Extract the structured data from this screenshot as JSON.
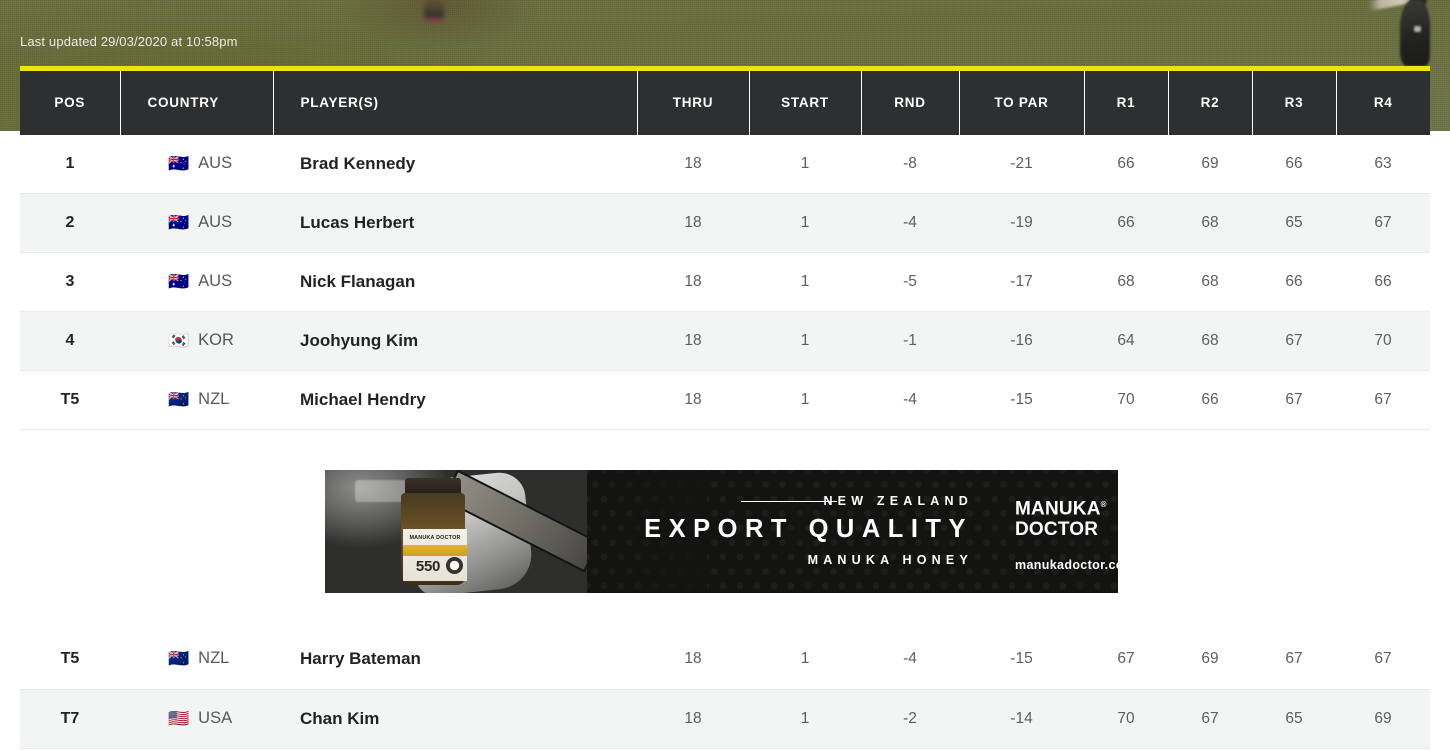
{
  "hero": {
    "last_updated": "Last updated 29/03/2020 at 10:58pm"
  },
  "colors": {
    "accent_yellow": "#f2e310",
    "header_dark": "#2d2f30",
    "row_alt": "#f3f4f4",
    "text_dark": "#1f2326",
    "text_muted": "#55595c",
    "ad_black": "#131312",
    "ad_gold": "#d4b765"
  },
  "leaderboard": {
    "columns": [
      {
        "key": "pos",
        "label": "POS"
      },
      {
        "key": "country",
        "label": "COUNTRY"
      },
      {
        "key": "player",
        "label": "PLAYER(S)"
      },
      {
        "key": "thru",
        "label": "THRU"
      },
      {
        "key": "start",
        "label": "START"
      },
      {
        "key": "rnd",
        "label": "RND"
      },
      {
        "key": "topar",
        "label": "TO PAR"
      },
      {
        "key": "r1",
        "label": "R1"
      },
      {
        "key": "r2",
        "label": "R2"
      },
      {
        "key": "r3",
        "label": "R3"
      },
      {
        "key": "r4",
        "label": "R4"
      }
    ],
    "rows_top": [
      {
        "pos": "1",
        "flag": "🇦🇺",
        "country": "AUS",
        "player": "Brad Kennedy",
        "thru": "18",
        "start": "1",
        "rnd": "-8",
        "topar": "-21",
        "r1": "66",
        "r2": "69",
        "r3": "66",
        "r4": "63"
      },
      {
        "pos": "2",
        "flag": "🇦🇺",
        "country": "AUS",
        "player": "Lucas Herbert",
        "thru": "18",
        "start": "1",
        "rnd": "-4",
        "topar": "-19",
        "r1": "66",
        "r2": "68",
        "r3": "65",
        "r4": "67"
      },
      {
        "pos": "3",
        "flag": "🇦🇺",
        "country": "AUS",
        "player": "Nick Flanagan",
        "thru": "18",
        "start": "1",
        "rnd": "-5",
        "topar": "-17",
        "r1": "68",
        "r2": "68",
        "r3": "66",
        "r4": "66"
      },
      {
        "pos": "4",
        "flag": "🇰🇷",
        "country": "KOR",
        "player": "Joohyung Kim",
        "thru": "18",
        "start": "1",
        "rnd": "-1",
        "topar": "-16",
        "r1": "64",
        "r2": "68",
        "r3": "67",
        "r4": "70"
      },
      {
        "pos": "T5",
        "flag": "🇳🇿",
        "country": "NZL",
        "player": "Michael Hendry",
        "thru": "18",
        "start": "1",
        "rnd": "-4",
        "topar": "-15",
        "r1": "70",
        "r2": "66",
        "r3": "67",
        "r4": "67"
      }
    ],
    "rows_bottom": [
      {
        "pos": "T5",
        "flag": "🇳🇿",
        "country": "NZL",
        "player": "Harry Bateman",
        "thru": "18",
        "start": "1",
        "rnd": "-4",
        "topar": "-15",
        "r1": "67",
        "r2": "69",
        "r3": "67",
        "r4": "67"
      },
      {
        "pos": "T7",
        "flag": "🇺🇸",
        "country": "USA",
        "player": "Chan Kim",
        "thru": "18",
        "start": "1",
        "rnd": "-2",
        "topar": "-14",
        "r1": "70",
        "r2": "67",
        "r3": "65",
        "r4": "69"
      }
    ]
  },
  "advert": {
    "jar_brand": "MANUKA DOCTOR",
    "jar_grade": "550",
    "line1": "NEW ZEALAND",
    "line2": "EXPORT QUALITY",
    "line3": "MANUKA HONEY",
    "brand_line1": "MANUKA",
    "brand_line2": "DOCTOR",
    "registered_mark": "®",
    "url": "manukadoctor.co.nz"
  }
}
